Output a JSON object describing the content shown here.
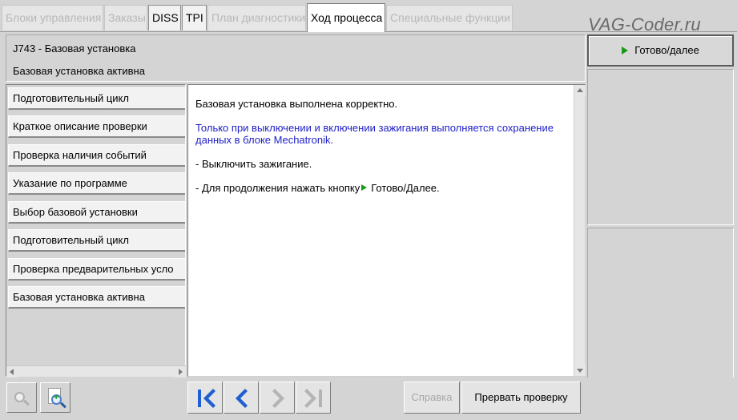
{
  "tabs": [
    {
      "label": "Блоки управления",
      "state": "disabled"
    },
    {
      "label": "Заказы",
      "state": "disabled"
    },
    {
      "label": "DISS",
      "state": "enabled"
    },
    {
      "label": "TPI",
      "state": "enabled"
    },
    {
      "label": "План диагностики",
      "state": "disabled"
    },
    {
      "label": "Ход процесса",
      "state": "active"
    },
    {
      "label": "Специальные функции",
      "state": "disabled"
    }
  ],
  "watermark": "VAG-Coder.ru",
  "header": {
    "title": "J743 - Базовая установка",
    "status": "Базовая установка активна"
  },
  "right_panel": {
    "next_button_label": "Готово/далее"
  },
  "steps": [
    "Подготовительный цикл",
    "Краткое описание проверки",
    "Проверка наличия событий",
    "Указание по программе",
    "Выбор базовой установки",
    "Подготовительный цикл",
    "Проверка предварительных усло",
    "Базовая установка активна"
  ],
  "content": {
    "line1": "Базовая установка выполнена корректно.",
    "line2": "Только при выключении и включении зажигания выполняется сохранение данных в блоке Mechatronik.",
    "line3": "- Выключить зажигание.",
    "line4_prefix": "- Для продолжения нажать кнопку",
    "line4_button": "Готово/Далее."
  },
  "toolbar": {
    "help_label": "Справка",
    "abort_label": "Прервать проверку"
  },
  "colors": {
    "accent_blue": "#2020c8",
    "green_arrow": "#1a9a1a",
    "nav_blue": "#1f5fd1"
  },
  "icons": [
    "zoom-out-icon",
    "zoom-document-icon",
    "first-step-icon",
    "previous-step-icon",
    "next-step-icon",
    "last-step-icon",
    "play-arrow-icon"
  ]
}
